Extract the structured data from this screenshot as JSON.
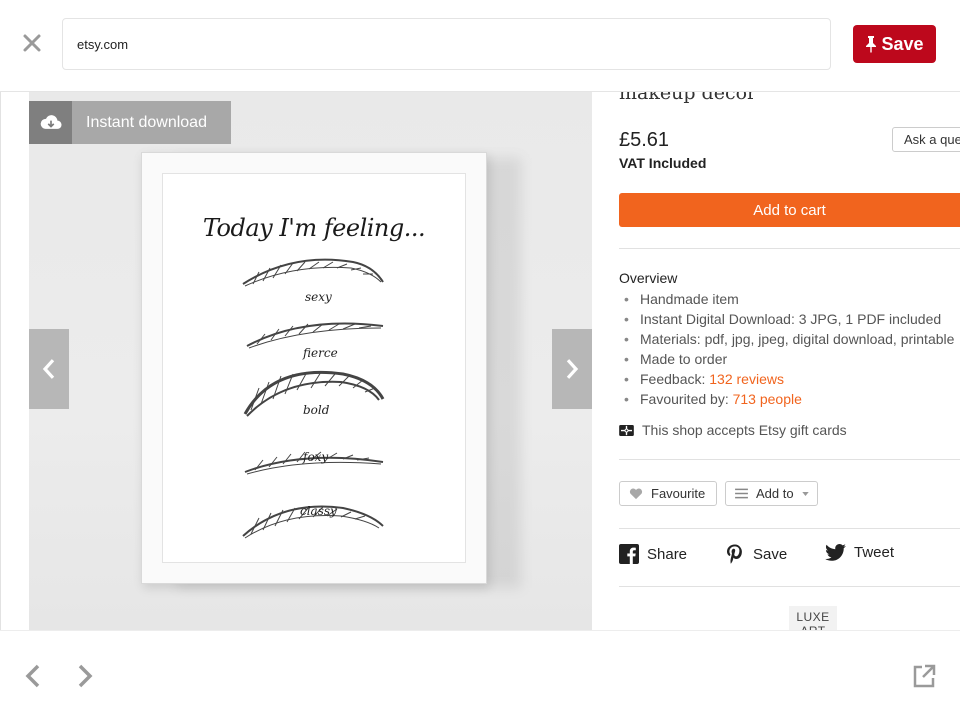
{
  "topbar": {
    "url": "etsy.com",
    "save_label": "Save",
    "colors": {
      "save_bg": "#bd081c"
    }
  },
  "image": {
    "badge_label": "Instant download",
    "print_title": "Today I'm feeling...",
    "words": [
      "sexy",
      "fierce",
      "bold",
      "foxy",
      "classy"
    ]
  },
  "product": {
    "title": "makeup decor",
    "price": "£5.61",
    "vat": "VAT Included",
    "ask_question": "Ask a question",
    "add_to_cart": "Add to cart",
    "overview_heading": "Overview",
    "overview": [
      {
        "text": "Handmade item",
        "link": ""
      },
      {
        "text": "Instant Digital Download: 3 JPG, 1 PDF included",
        "link": ""
      },
      {
        "text": "Materials: pdf, jpg, jpeg, digital download, printable",
        "link": ""
      },
      {
        "text": "Made to order",
        "link": ""
      },
      {
        "text": "Feedback: ",
        "link": "132 reviews"
      },
      {
        "text": "Favourited by: ",
        "link": "713 people"
      }
    ],
    "gift_card": "This shop accepts Etsy gift cards",
    "favourite": "Favourite",
    "add_to": "Add to",
    "share": {
      "facebook": "Share",
      "pinterest": "Save",
      "twitter": "Tweet"
    },
    "shop_logo": "LUXE ART",
    "colors": {
      "accent": "#f1641e"
    }
  },
  "icons": {
    "close": "close-icon",
    "pin": "pushpin-icon",
    "cloud": "cloud-download-icon",
    "prev": "chevron-left-icon",
    "next": "chevron-right-icon",
    "gift": "gift-card-icon",
    "heart": "heart-icon",
    "list": "list-icon",
    "facebook": "facebook-icon",
    "pinterest": "pinterest-icon",
    "twitter": "twitter-icon",
    "external": "external-link-icon"
  }
}
